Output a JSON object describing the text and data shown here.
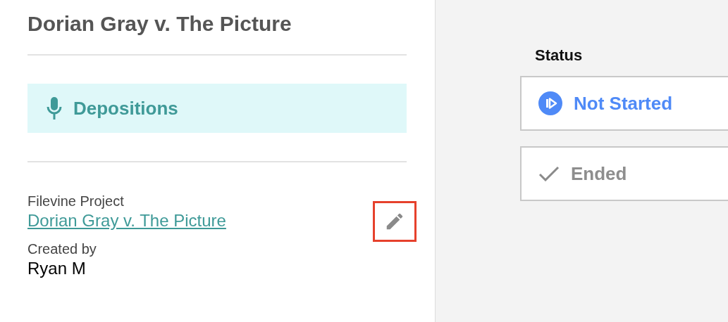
{
  "title": "Dorian Gray v. The Picture",
  "category": {
    "label": "Depositions"
  },
  "fields": [
    {
      "label": "Filevine Project",
      "value": "Dorian Gray v. The Picture",
      "kind": "link",
      "editable": true,
      "highlighted": true
    },
    {
      "label": "Created by",
      "value": "Ryan M",
      "kind": "text"
    }
  ],
  "status": {
    "heading": "Status",
    "options": [
      {
        "label": "Not Started",
        "kind": "not_started",
        "selected": true
      },
      {
        "label": "Ended",
        "kind": "ended",
        "selected": false
      }
    ]
  }
}
